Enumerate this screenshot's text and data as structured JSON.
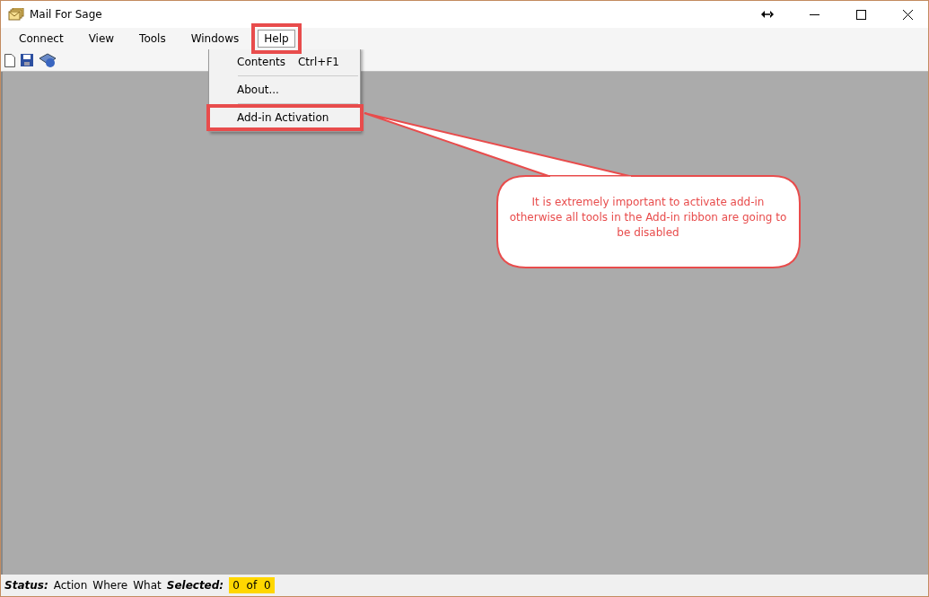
{
  "window": {
    "title": "Mail For Sage"
  },
  "menu": [
    {
      "label": "Connect",
      "selected": false,
      "highlighted": false
    },
    {
      "label": "View",
      "selected": false,
      "highlighted": false
    },
    {
      "label": "Tools",
      "selected": false,
      "highlighted": false
    },
    {
      "label": "Windows",
      "selected": false,
      "highlighted": false
    },
    {
      "label": "Help",
      "selected": true,
      "highlighted": true
    }
  ],
  "dropdown": [
    {
      "kind": "item",
      "label": "Contents",
      "shortcut": "Ctrl+F1",
      "highlighted": false
    },
    {
      "kind": "separator"
    },
    {
      "kind": "item",
      "label": "About...",
      "highlighted": false
    },
    {
      "kind": "separator"
    },
    {
      "kind": "item",
      "label": "Add-in Activation",
      "highlighted": true
    }
  ],
  "callout": {
    "text": "It is extremely important to activate add-in otherwise all tools in the Add-in ribbon are going to be disabled"
  },
  "status_bar": [
    {
      "kind": "label",
      "text": "Status:"
    },
    {
      "kind": "text",
      "text": "Action"
    },
    {
      "kind": "text",
      "text": "Where"
    },
    {
      "kind": "text",
      "text": "What"
    },
    {
      "kind": "label",
      "text": "Selected:"
    },
    {
      "kind": "count",
      "text": "0 of 0"
    }
  ]
}
